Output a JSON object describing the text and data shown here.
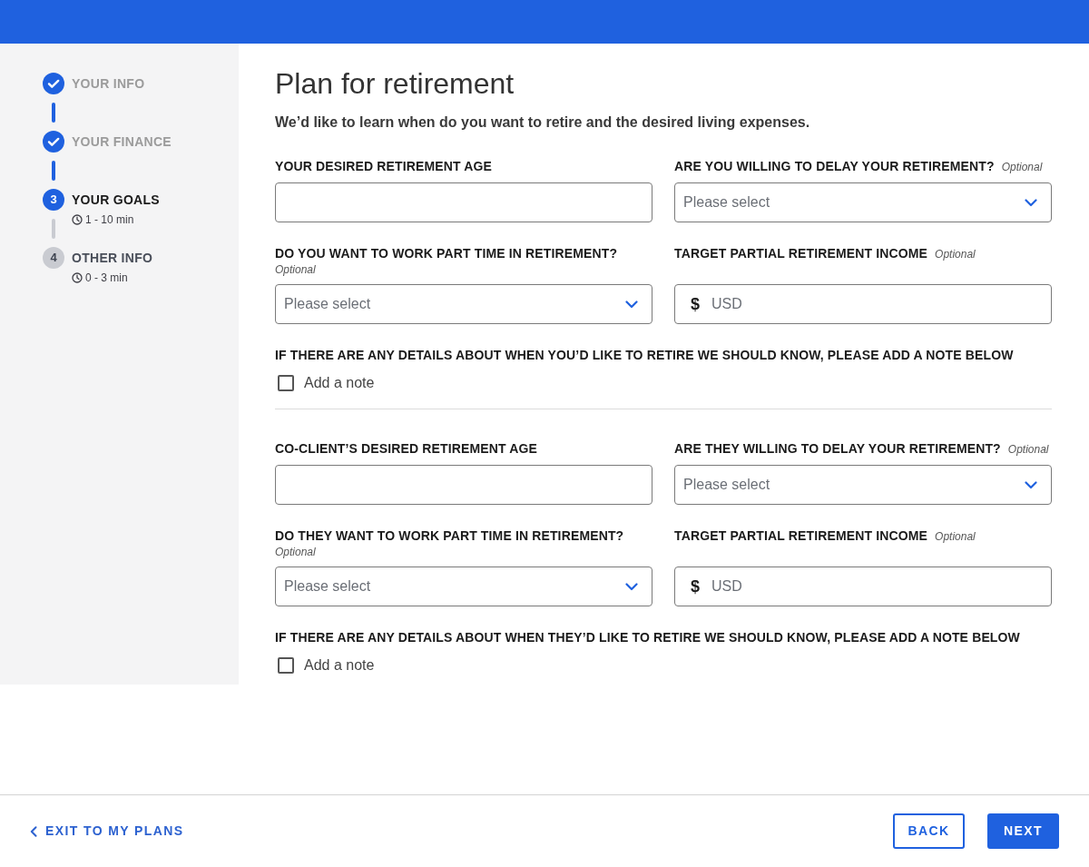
{
  "steps": [
    {
      "label": "YOUR INFO",
      "completed": true,
      "current": false
    },
    {
      "label": "YOUR FINANCE",
      "completed": true,
      "current": false
    },
    {
      "label": "YOUR GOALS",
      "completed": false,
      "current": true,
      "number": "3",
      "duration": "1 - 10 min"
    },
    {
      "label": "OTHER INFO",
      "completed": false,
      "current": false,
      "number": "4",
      "duration": "0 - 3 min"
    }
  ],
  "page": {
    "title": "Plan for retirement",
    "subtitle": "We’d like to learn when do you want to retire and the desired living expenses."
  },
  "sections": [
    {
      "fields": [
        {
          "kind": "text",
          "label": "YOUR DESIRED RETIREMENT AGE"
        },
        {
          "kind": "select",
          "label": "ARE YOU WILLING TO DELAY YOUR RETIREMENT?",
          "optional": "Optional",
          "placeholder": "Please select"
        },
        {
          "kind": "select",
          "label": "DO YOU WANT TO WORK PART TIME IN RETIREMENT?",
          "optional": "Optional",
          "placeholder": "Please select"
        },
        {
          "kind": "currency",
          "label": "TARGET PARTIAL RETIREMENT INCOME",
          "optional": "Optional",
          "symbol": "$",
          "placeholder": "USD"
        }
      ],
      "note": {
        "label": "IF THERE ARE ANY DETAILS ABOUT WHEN YOU’D LIKE TO RETIRE WE SHOULD KNOW, PLEASE ADD A NOTE BELOW",
        "checkbox_label": "Add a note",
        "checked": false
      }
    },
    {
      "fields": [
        {
          "kind": "text",
          "label": "CO-CLIENT’S DESIRED RETIREMENT AGE"
        },
        {
          "kind": "select",
          "label": "ARE THEY WILLING TO DELAY YOUR RETIREMENT?",
          "optional": "Optional",
          "placeholder": "Please select"
        },
        {
          "kind": "select",
          "label": "DO THEY WANT TO WORK PART TIME IN RETIREMENT?",
          "optional": "Optional",
          "placeholder": "Please select"
        },
        {
          "kind": "currency",
          "label": "TARGET PARTIAL RETIREMENT INCOME",
          "optional": "Optional",
          "symbol": "$",
          "placeholder": "USD"
        }
      ],
      "note": {
        "label": "IF THERE ARE ANY DETAILS ABOUT WHEN THEY’D LIKE TO RETIRE WE SHOULD KNOW, PLEASE ADD A NOTE BELOW",
        "checkbox_label": "Add a note",
        "checked": false
      }
    }
  ],
  "footer": {
    "exit_link": "EXIT TO MY PLANS",
    "buttons": [
      {
        "label": "BACK",
        "kind": "secondary"
      },
      {
        "label": "NEXT",
        "kind": "primary"
      }
    ]
  }
}
